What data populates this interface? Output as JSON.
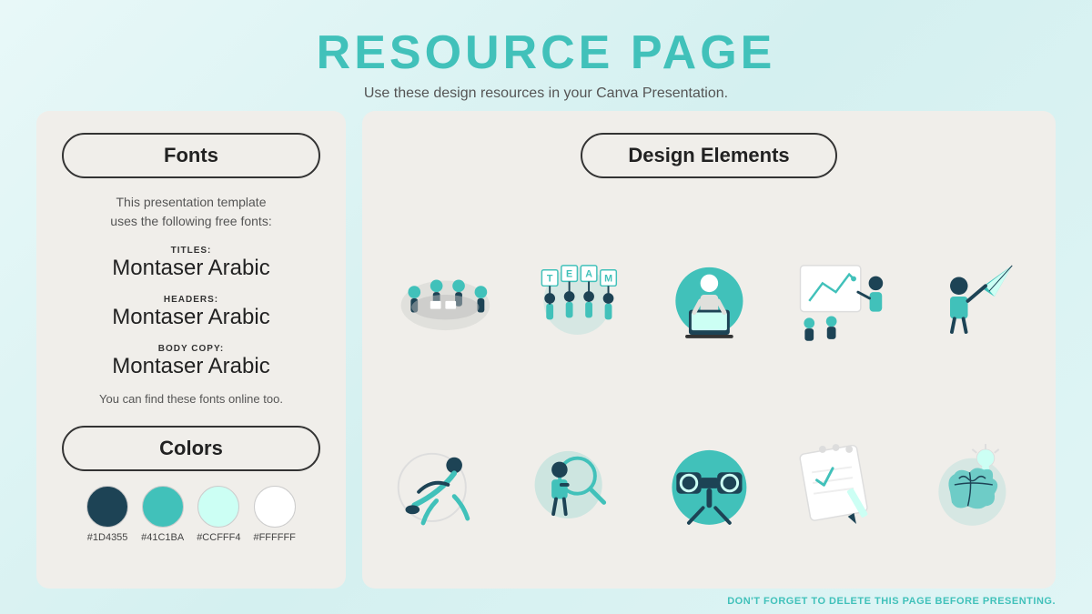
{
  "header": {
    "title": "RESOURCE PAGE",
    "subtitle": "Use these design resources in your Canva Presentation."
  },
  "left_panel": {
    "fonts_section": {
      "label": "Fonts",
      "intro_line1": "This presentation template",
      "intro_line2": "uses the following free fonts:",
      "entries": [
        {
          "label": "TITLES:",
          "name": "Montaser Arabic"
        },
        {
          "label": "HEADERS:",
          "name": "Montaser Arabic"
        },
        {
          "label": "BODY COPY:",
          "name": "Montaser Arabic"
        }
      ],
      "note": "You can find these fonts online too."
    },
    "colors_section": {
      "label": "Colors",
      "swatches": [
        {
          "hex": "#1D4355",
          "label": "#1D4355"
        },
        {
          "hex": "#41C1BA",
          "label": "#41C1BA"
        },
        {
          "hex": "#CCFFF4",
          "label": "#CCFFF4"
        },
        {
          "hex": "#FFFFFF",
          "label": "#FFFFFF"
        }
      ]
    }
  },
  "right_panel": {
    "label": "Design Elements"
  },
  "footer": {
    "note": "DON'T FORGET TO DELETE THIS PAGE BEFORE PRESENTING."
  }
}
